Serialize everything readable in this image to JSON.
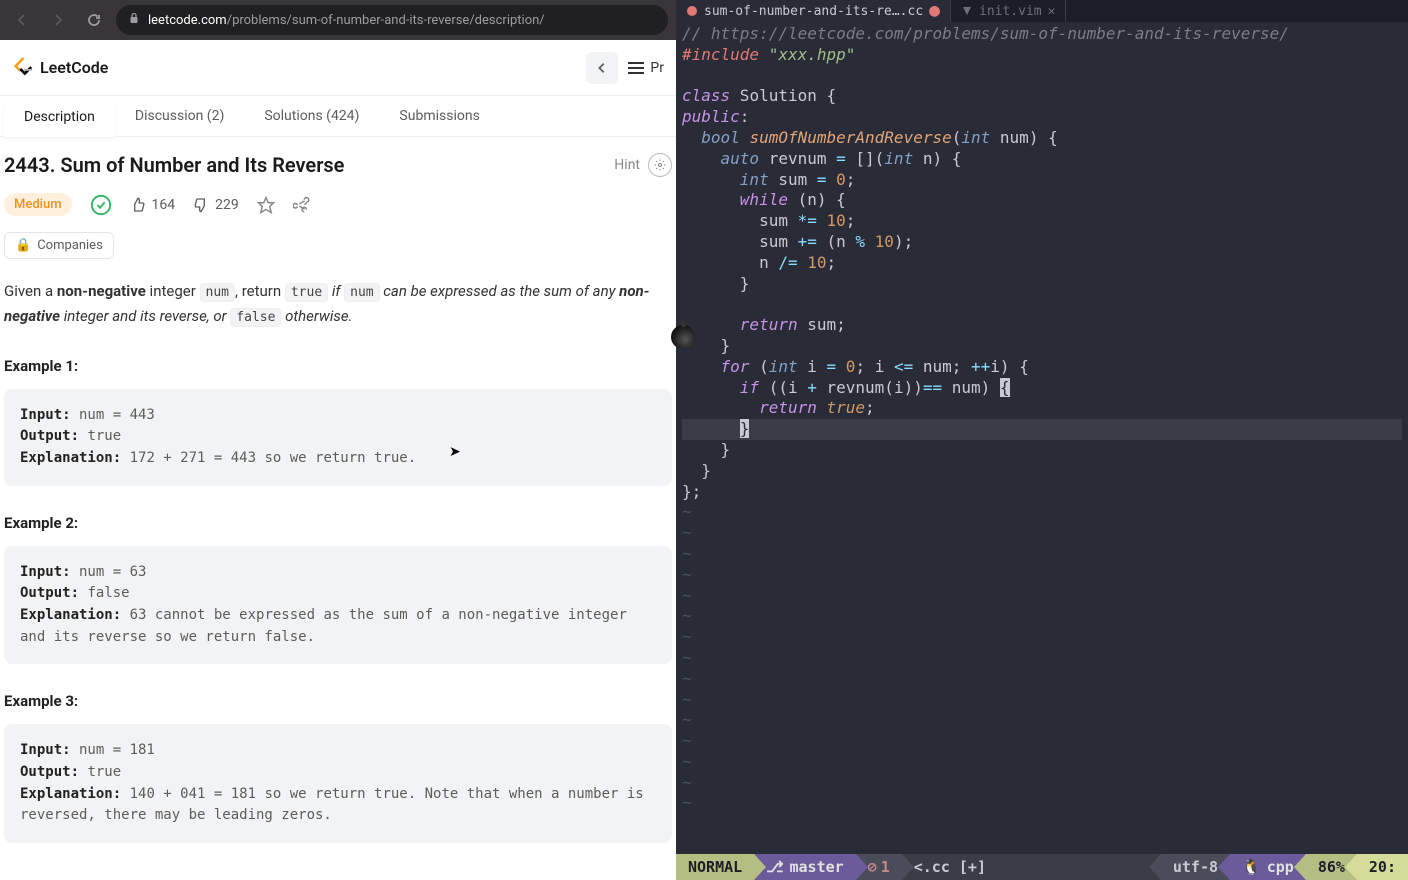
{
  "browser": {
    "url_domain": "leetcode.com",
    "url_path": "/problems/sum-of-number-and-its-reverse/description/"
  },
  "header": {
    "logo_text": "LeetCode",
    "menu_prefix": "Pr"
  },
  "tabs": {
    "description": "Description",
    "discussion": "Discussion (2)",
    "solutions": "Solutions (424)",
    "submissions": "Submissions"
  },
  "problem": {
    "title": "2443. Sum of Number and Its Reverse",
    "hint": "Hint",
    "difficulty": "Medium",
    "likes": "164",
    "dislikes": "229",
    "companies": "Companies",
    "desc_p1": "Given a ",
    "desc_b1": "non-negative",
    "desc_p2": " integer ",
    "desc_c1": "num",
    "desc_p3": ", return ",
    "desc_c2": "true",
    "desc_i1": " if ",
    "desc_c3": "num",
    "desc_i2": " can be expressed as the sum of any ",
    "desc_b2": "non-negative",
    "desc_i3": " integer and its reverse, or ",
    "desc_c4": "false",
    "desc_i4": " otherwise."
  },
  "examples": [
    {
      "heading": "Example 1:",
      "input_label": "Input:",
      "input": " num = 443",
      "output_label": "Output:",
      "output": " true",
      "explanation_label": "Explanation:",
      "explanation": " 172 + 271 = 443 so we return true."
    },
    {
      "heading": "Example 2:",
      "input_label": "Input:",
      "input": " num = 63",
      "output_label": "Output:",
      "output": " false",
      "explanation_label": "Explanation:",
      "explanation": " 63 cannot be expressed as the sum of a non-negative integer and its reverse so we return false."
    },
    {
      "heading": "Example 3:",
      "input_label": "Input:",
      "input": " num = 181",
      "output_label": "Output:",
      "output": " true",
      "explanation_label": "Explanation:",
      "explanation": " 140 + 041 = 181 so we return true. Note that when a number is reversed, there may be leading zeros."
    }
  ],
  "vim": {
    "tab1": "sum-of-number-and-its-re….cc",
    "tab2": "init.vim",
    "status": {
      "mode": "NORMAL",
      "branch": "master",
      "errors": "1",
      "file": "<.cc [+]",
      "encoding": "utf-8",
      "filetype": "cpp",
      "percent": "86%",
      "position": "20:"
    }
  }
}
